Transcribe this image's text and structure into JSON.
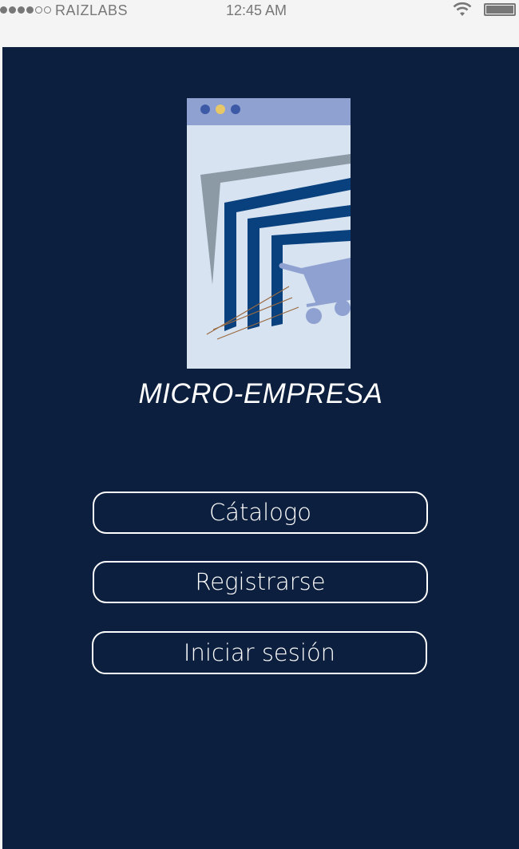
{
  "status_bar": {
    "carrier": "RAIZLABS",
    "time": "12:45 AM",
    "signal_icon": "signal-dots-icon",
    "wifi_icon": "wifi-icon",
    "battery_icon": "battery-icon"
  },
  "app": {
    "background_color": "#0c1f3e",
    "logo_icon": "warehouse-cart-logo",
    "title": "MICRO-EMPRESA"
  },
  "menu": {
    "catalog_label": "Cátalogo",
    "register_label": "Registrarse",
    "login_label": "Iniciar sesión"
  }
}
